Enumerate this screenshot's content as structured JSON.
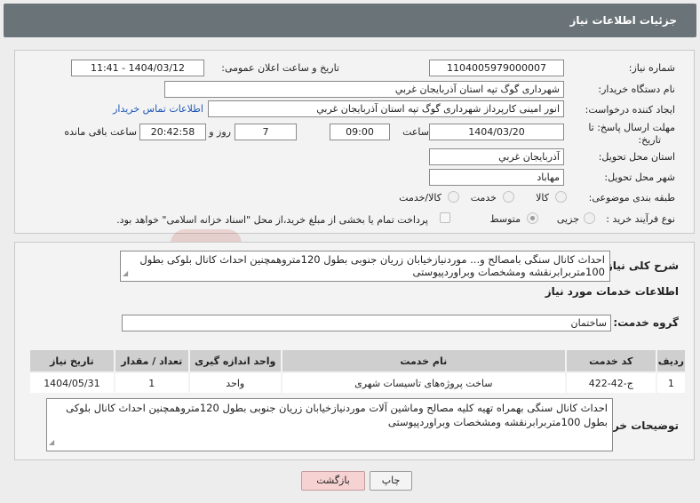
{
  "header": {
    "title": "جزئیات اطلاعات نیاز"
  },
  "fields": {
    "need_number_label": "شماره نیاز:",
    "need_number": "1104005979000007",
    "announce_label": "تاریخ و ساعت اعلان عمومی:",
    "announce_value": "1404/03/12 - 11:41",
    "buyer_org_label": "نام دستگاه خریدار:",
    "buyer_org": "شهرداری گوگ تپه استان آذربایجان غربي",
    "creator_label": "ایجاد کننده درخواست:",
    "creator": "انور امینی کارپرداز شهرداری گوگ تپه استان آذربایجان غربي",
    "contact_link": "اطلاعات تماس خریدار",
    "deadline_label_line1": "مهلت ارسال پاسخ: تا",
    "deadline_label_line2": "تاریخ:",
    "deadline_date": "1404/03/20",
    "time_label": "ساعت",
    "deadline_time": "09:00",
    "days_value": "7",
    "days_label": "روز و",
    "remaining_time": "20:42:58",
    "remaining_label": "ساعت باقی مانده",
    "province_label": "استان محل تحویل:",
    "province": "آذربایجان غربي",
    "city_label": "شهر محل تحویل:",
    "city": "مهاباد",
    "category_label": "طبقه بندی موضوعی:",
    "category_options": [
      "کالا",
      "خدمت",
      "کالا/خدمت"
    ],
    "process_label": "نوع فرآیند خرید :",
    "process_options": [
      "جزیی",
      "متوسط"
    ],
    "payment_note": "پرداخت تمام یا بخشی از مبلغ خرید،از محل \"اسناد خزانه اسلامی\" خواهد بود."
  },
  "summary": {
    "label": "شرح کلی نیاز:",
    "text": "احداث کانال سنگی بامصالح و... موردنیازخیابان زریان جنوبی بطول 120متروهمچنین احداث کانال بلوکی بطول 100متربرابرنقشه ومشخصات وبراوردپیوستی"
  },
  "services": {
    "title": "اطلاعات خدمات مورد نیاز",
    "group_label": "گروه خدمت:",
    "group_value": "ساختمان",
    "columns": [
      "ردیف",
      "کد خدمت",
      "نام خدمت",
      "واحد اندازه گیری",
      "تعداد / مقدار",
      "تاریخ نیاز"
    ],
    "rows": [
      [
        "1",
        "ج-42-422",
        "ساخت پروژه‌های تاسیسات شهری",
        "واحد",
        "1",
        "1404/05/31"
      ]
    ]
  },
  "buyer_notes": {
    "label": "توضیحات خریدار:",
    "text": "احداث کانال سنگی بهمراه تهیه کلیه مصالح وماشین آلات موردنیازخیابان زریان جنوبی بطول 120متروهمچنین احداث کانال بلوکی بطول 100متربرابرنقشه ومشخصات وبراوردپیوستی"
  },
  "buttons": {
    "print": "چاپ",
    "back": "بازگشت"
  },
  "watermark": {
    "text": "AriaTender.net"
  },
  "colors": {
    "header_bg": "#6a7478",
    "link": "#1f57b5",
    "back_button_bg": "#f6d2d2"
  }
}
